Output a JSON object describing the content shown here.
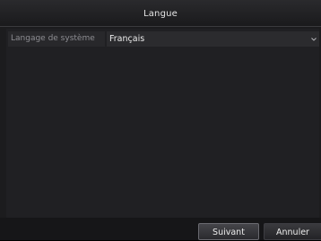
{
  "window": {
    "title": "Langue"
  },
  "settings": {
    "language_label": "Langage de système",
    "language_value": "Français",
    "dropdown_icon": "chevron-down-icon"
  },
  "footer": {
    "next_label": "Suivant",
    "cancel_label": "Annuler"
  },
  "colors": {
    "background": "#1c1c1e",
    "panel": "#202023",
    "text": "#ececec",
    "muted_text": "#8d8d92"
  }
}
